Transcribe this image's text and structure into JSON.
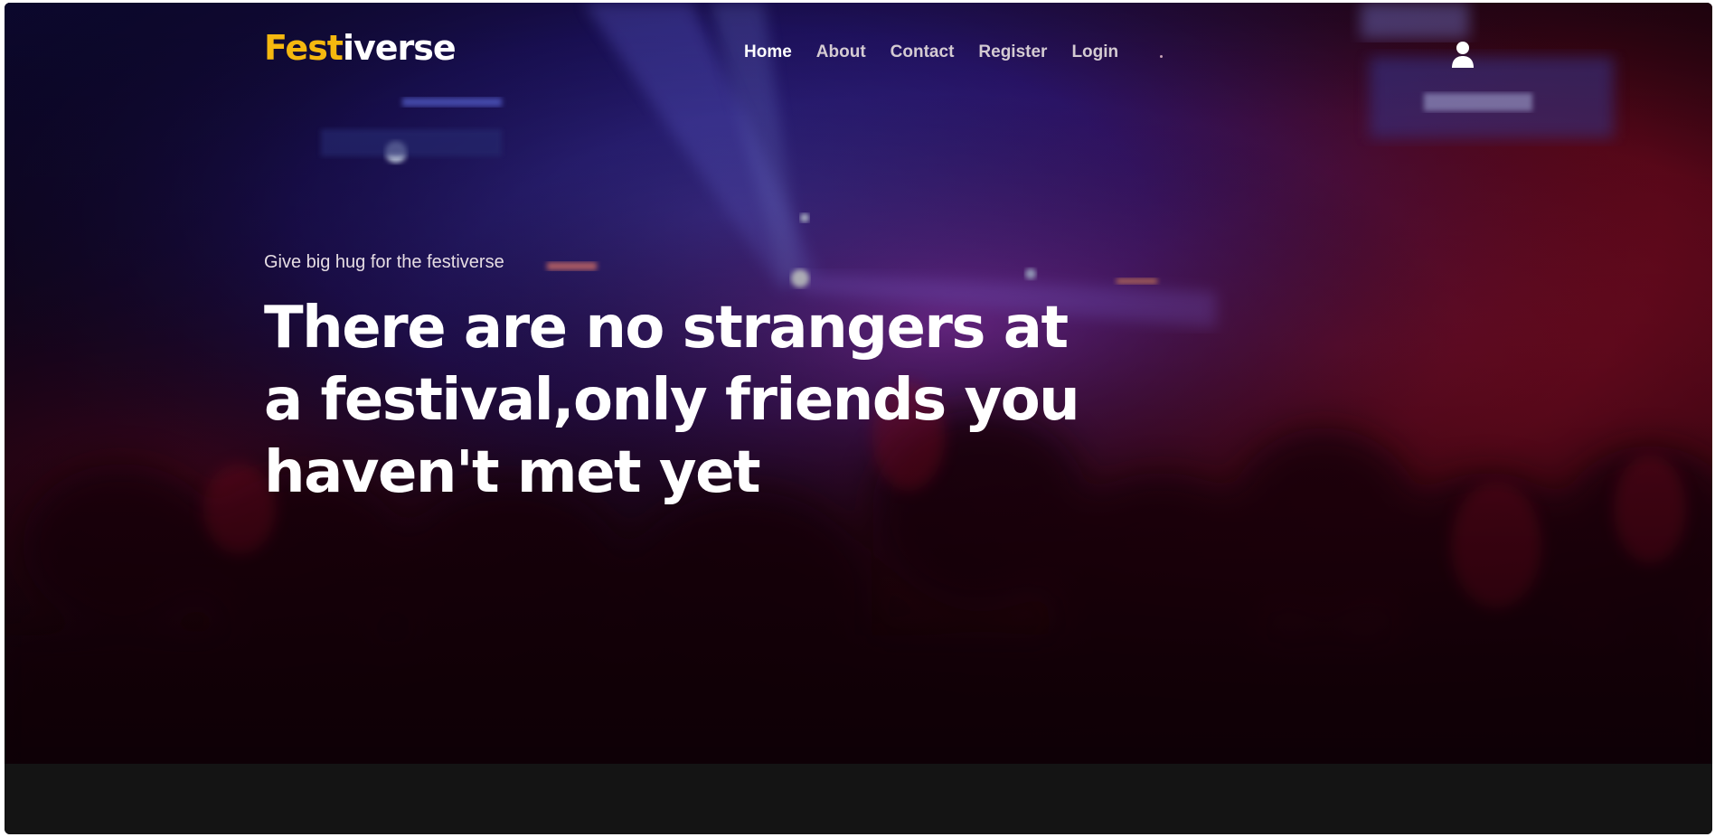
{
  "brand": {
    "logo_accent": "Fest",
    "logo_rest": "iverse",
    "accent_color": "#f5b80f"
  },
  "nav": {
    "items": [
      {
        "label": "Home",
        "active": true
      },
      {
        "label": "About",
        "active": false
      },
      {
        "label": "Contact",
        "active": false
      },
      {
        "label": "Register",
        "active": false
      },
      {
        "label": "Login",
        "active": false
      }
    ],
    "user_icon": "user-icon"
  },
  "hero": {
    "tagline": "Give big hug for the festiverse",
    "headline": "There are no strangers at a festival,only friends you haven't met yet",
    "background": "concert-crowd-image"
  },
  "colors": {
    "hero_blue": "#3a2fd0",
    "hero_red": "#b0102a",
    "footer_bg": "#141414"
  }
}
